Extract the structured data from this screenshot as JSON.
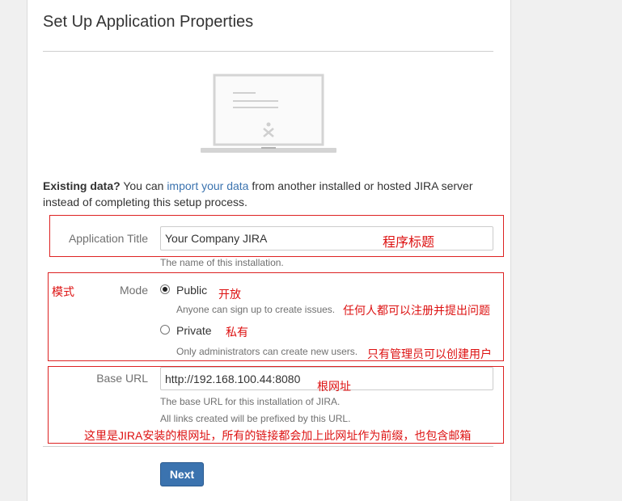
{
  "page": {
    "title": "Set Up Application Properties"
  },
  "existing": {
    "bold": "Existing data?",
    "pre": " You can ",
    "link": "import your data",
    "post": " from another installed or hosted JIRA server instead of completing this setup process."
  },
  "form": {
    "app_title": {
      "label": "Application Title",
      "value": "Your Company JIRA",
      "desc": "The name of this installation.",
      "annotation": "程序标题"
    },
    "mode": {
      "label": "Mode",
      "annotation": "模式",
      "options": [
        {
          "label": "Public",
          "desc": "Anyone can sign up to create issues.",
          "annotation": "开放",
          "desc_annotation": "任何人都可以注册并提出问题",
          "checked": true
        },
        {
          "label": "Private",
          "desc": "Only administrators can create new users.",
          "annotation": "私有",
          "desc_annotation": "只有管理员可以创建用户",
          "checked": false
        }
      ]
    },
    "base_url": {
      "label": "Base URL",
      "value": "http://192.168.100.44:8080",
      "annotation": "根网址",
      "desc1": "The base URL for this installation of JIRA.",
      "desc2": "All links created will be prefixed by this URL.",
      "note": "这里是JIRA安装的根网址，所有的链接都会加上此网址作为前缀，也包含邮箱"
    },
    "next_label": "Next"
  },
  "colors": {
    "accent": "#3b73af",
    "annotation": "#dd1111",
    "button": "#3b73af"
  },
  "icons": {
    "illustration": "laptop-icon",
    "hero": "jira-logo-icon"
  }
}
